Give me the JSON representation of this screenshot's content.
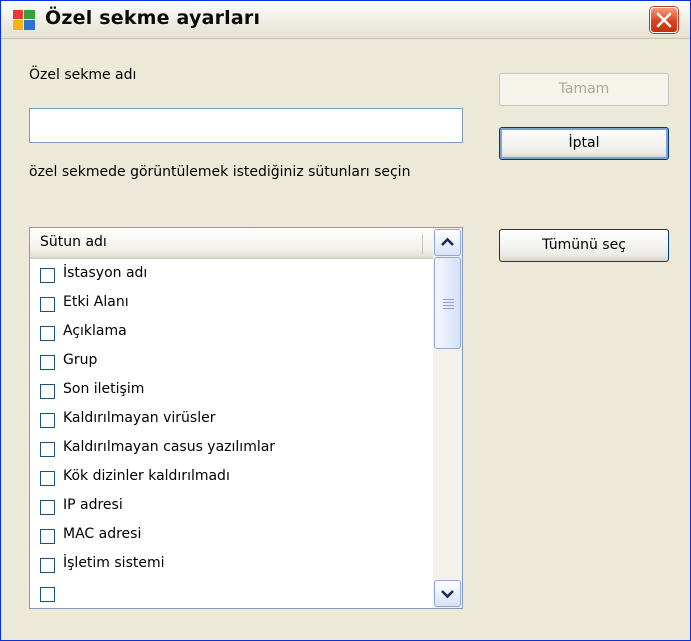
{
  "window": {
    "title": "Özel sekme ayarları",
    "close_icon": "close-icon",
    "app_icon": "avg-logo-icon"
  },
  "form": {
    "name_label": "Özel sekme adı",
    "name_value": "",
    "instruction": "özel sekmede görüntülemek istediğiniz sütunları seçin"
  },
  "buttons": {
    "ok": "Tamam",
    "cancel": "İptal",
    "select_all": "Tümünü seç"
  },
  "list": {
    "header": "Sütun adı",
    "items": [
      {
        "label": "İstasyon adı",
        "checked": false
      },
      {
        "label": "Etki Alanı",
        "checked": false
      },
      {
        "label": "Açıklama",
        "checked": false
      },
      {
        "label": "Grup",
        "checked": false
      },
      {
        "label": "Son iletişim",
        "checked": false
      },
      {
        "label": "Kaldırılmayan virüsler",
        "checked": false
      },
      {
        "label": "Kaldırılmayan casus yazılımlar",
        "checked": false
      },
      {
        "label": "Kök dizinler kaldırılmadı",
        "checked": false
      },
      {
        "label": "IP adresi",
        "checked": false
      },
      {
        "label": "MAC adresi",
        "checked": false
      },
      {
        "label": "İşletim sistemi",
        "checked": false
      },
      {
        "label": "",
        "checked": false
      }
    ]
  },
  "colors": {
    "dialog_bg": "#ece9d8",
    "close_red": "#d9451f",
    "input_border": "#7f9db9",
    "disabled_text": "#aca899"
  }
}
